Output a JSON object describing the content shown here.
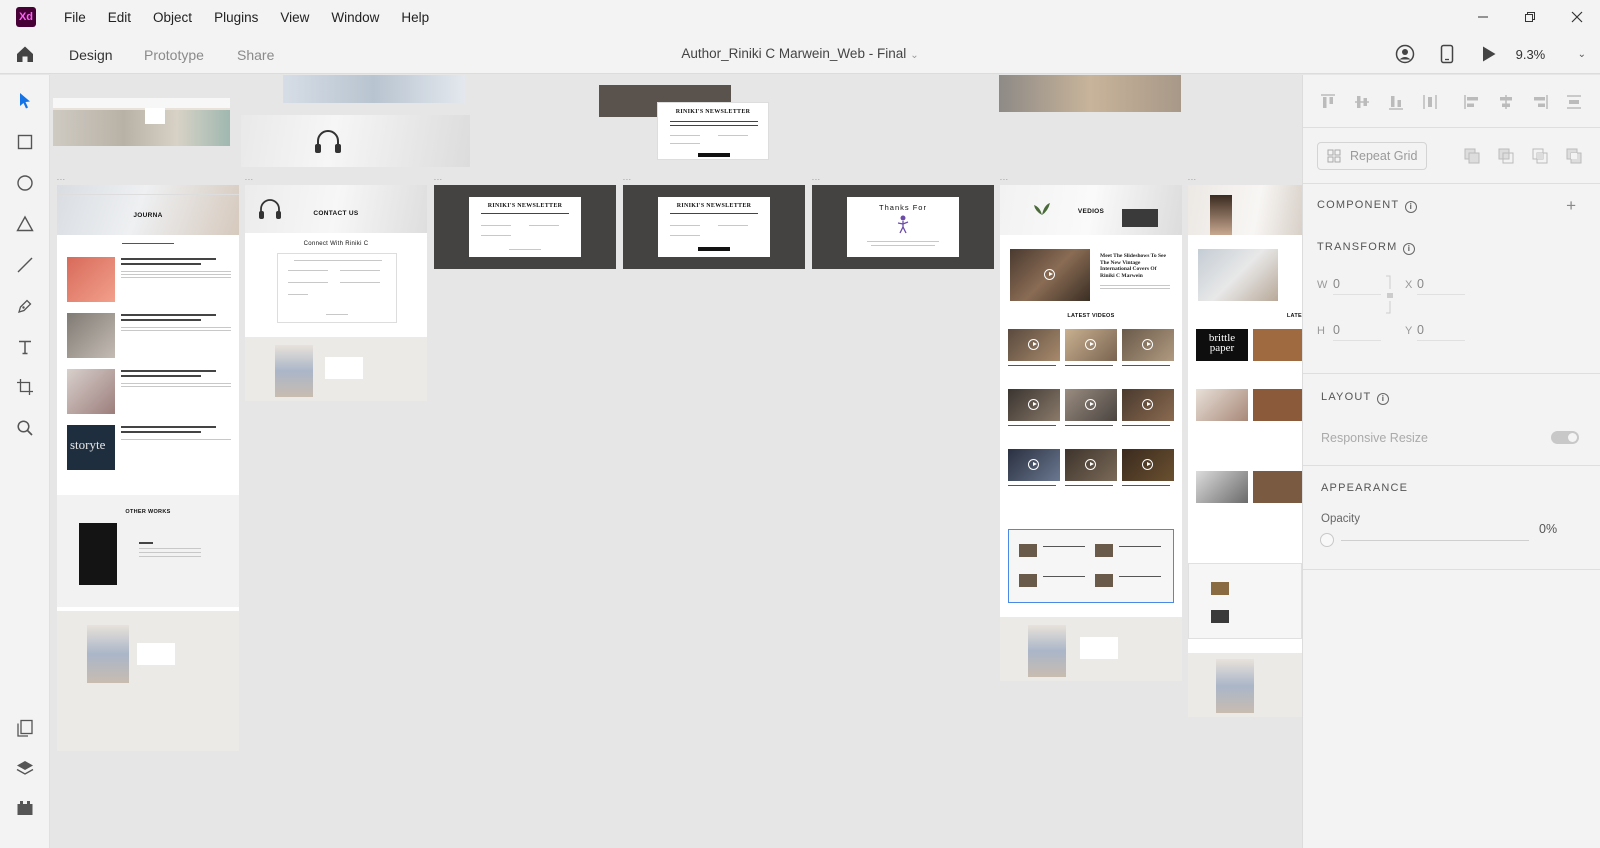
{
  "app": {
    "logo_text": "Xd",
    "menu": [
      "File",
      "Edit",
      "Object",
      "Plugins",
      "View",
      "Window",
      "Help"
    ]
  },
  "header": {
    "tabs": [
      "Design",
      "Prototype",
      "Share"
    ],
    "active_tab": "Design",
    "document_title": "Author_Riniki C Marwein_Web - Final",
    "zoom": "9.3%"
  },
  "canvas": {
    "board_labels": [
      "...",
      "...",
      "...",
      "...",
      "...",
      "...",
      "..."
    ],
    "boards": {
      "journal": {
        "heading": "JOURNA",
        "other_works": "OTHER WORKS"
      },
      "contact": {
        "heading": "CONTACT US",
        "subheading": "Connect With Riniki C"
      },
      "newsletter_a": {
        "title": "RINIKI'S NEWSLETTER"
      },
      "newsletter_b": {
        "title": "RINIKI'S NEWSLETTER"
      },
      "thanks": {
        "title": "Thanks For"
      },
      "videos": {
        "heading": "VEDIOS",
        "latest": "LATEST VIDEOS",
        "featured_title": "Meet The Slideshows To See The New Vintage International Covers Of Riniki C Marwein"
      },
      "books": {
        "heading": "LATE",
        "brand": "brittle paper"
      },
      "top_newsletter": {
        "title": "RINIKI'S NEWSLETTER"
      },
      "storyteller": {
        "text": "storyte"
      }
    }
  },
  "panel": {
    "repeat_grid": "Repeat Grid",
    "component": "COMPONENT",
    "transform": "TRANSFORM",
    "w_label": "W",
    "w_value": "0",
    "x_label": "X",
    "x_value": "0",
    "h_label": "H",
    "h_value": "0",
    "y_label": "Y",
    "y_value": "0",
    "layout": "LAYOUT",
    "responsive_resize": "Responsive Resize",
    "responsive_resize_on": false,
    "appearance": "APPEARANCE",
    "opacity_label": "Opacity",
    "opacity_value": "0%",
    "opacity_fraction": 0
  },
  "colors": {
    "accent": "#1473e6",
    "xd_brand": "#470137",
    "xd_brand_text": "#ff61f6",
    "chrome_bg": "#f3f3f3",
    "canvas_bg": "#e6e6e6"
  },
  "icons": {
    "tools": [
      "select-arrow-icon",
      "rectangle-icon",
      "ellipse-icon",
      "polygon-icon",
      "line-icon",
      "pen-icon",
      "text-icon",
      "artboard-icon",
      "zoom-icon"
    ],
    "bottom_tools": [
      "assets-icon",
      "layers-icon",
      "plugins-icon"
    ]
  }
}
